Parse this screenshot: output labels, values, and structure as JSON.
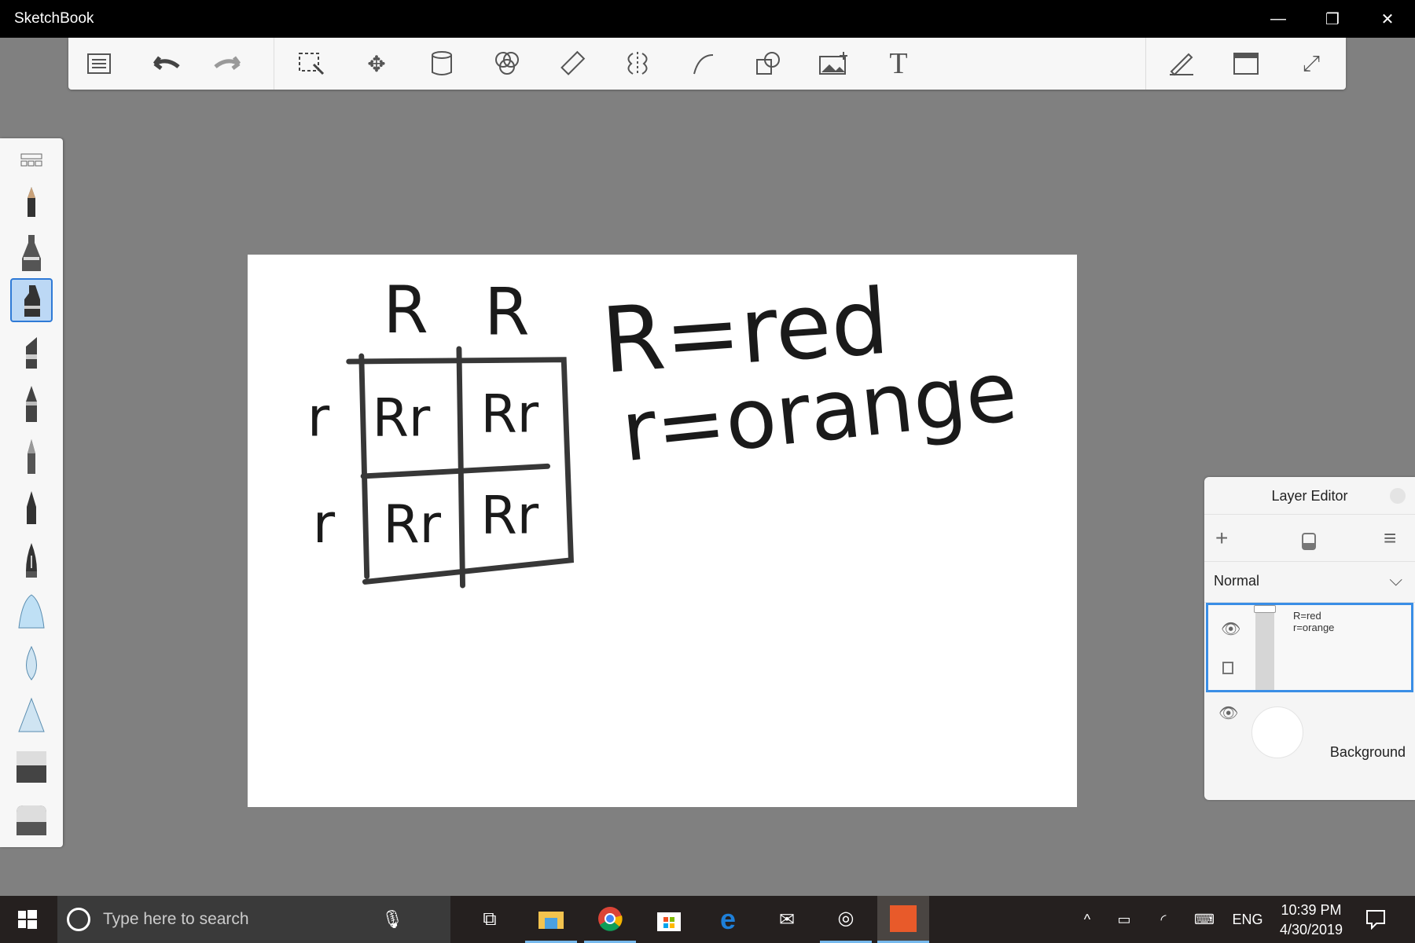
{
  "window": {
    "title": "SketchBook",
    "minimize": "—",
    "restore": "❐",
    "close": "✕"
  },
  "toolbar": {
    "icons": [
      "list-icon",
      "undo-icon",
      "redo-icon",
      "select-icon",
      "move-icon",
      "bucket-icon",
      "color-icon",
      "ruler-icon",
      "symmetry-icon",
      "curve-icon",
      "shapes-icon",
      "add-image-icon",
      "text-icon"
    ],
    "text_tool": "T"
  },
  "drawing": {
    "headers": [
      "R",
      "R"
    ],
    "rows": [
      "r",
      "r"
    ],
    "cells": [
      "Rr",
      "Rr",
      "Rr",
      "Rr"
    ],
    "line1": "R=red",
    "line2": "r=orange"
  },
  "layer_editor": {
    "title": "Layer Editor",
    "add": "+",
    "menu": "≡",
    "blend_mode": "Normal",
    "thumb_text1": "R=red",
    "thumb_text2": "r=orange",
    "background_label": "Background"
  },
  "taskbar": {
    "search_placeholder": "Type here to search",
    "lang": "ENG",
    "time": "10:39 PM",
    "date": "4/30/2019"
  }
}
